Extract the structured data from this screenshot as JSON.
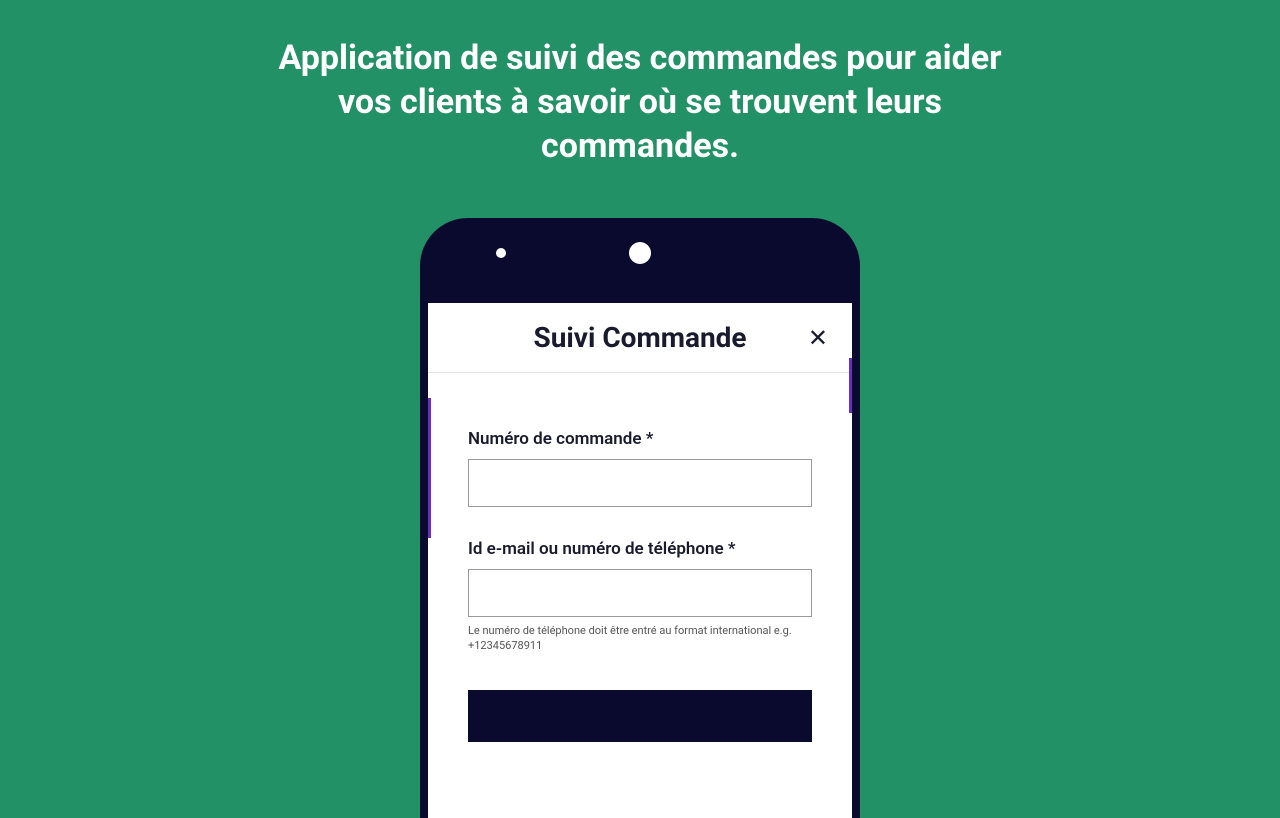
{
  "headline": "Application de suivi des commandes pour aider vos clients à savoir où se trouvent leurs commandes.",
  "modal": {
    "title": "Suivi Commande",
    "close": "✕",
    "order_label": "Numéro de commande *",
    "order_value": "",
    "contact_label": "Id e-mail ou numéro de téléphone *",
    "contact_value": "",
    "helper_text": "Le numéro de téléphone doit être entré au format international e.g. +12345678911",
    "submit_label": ""
  }
}
